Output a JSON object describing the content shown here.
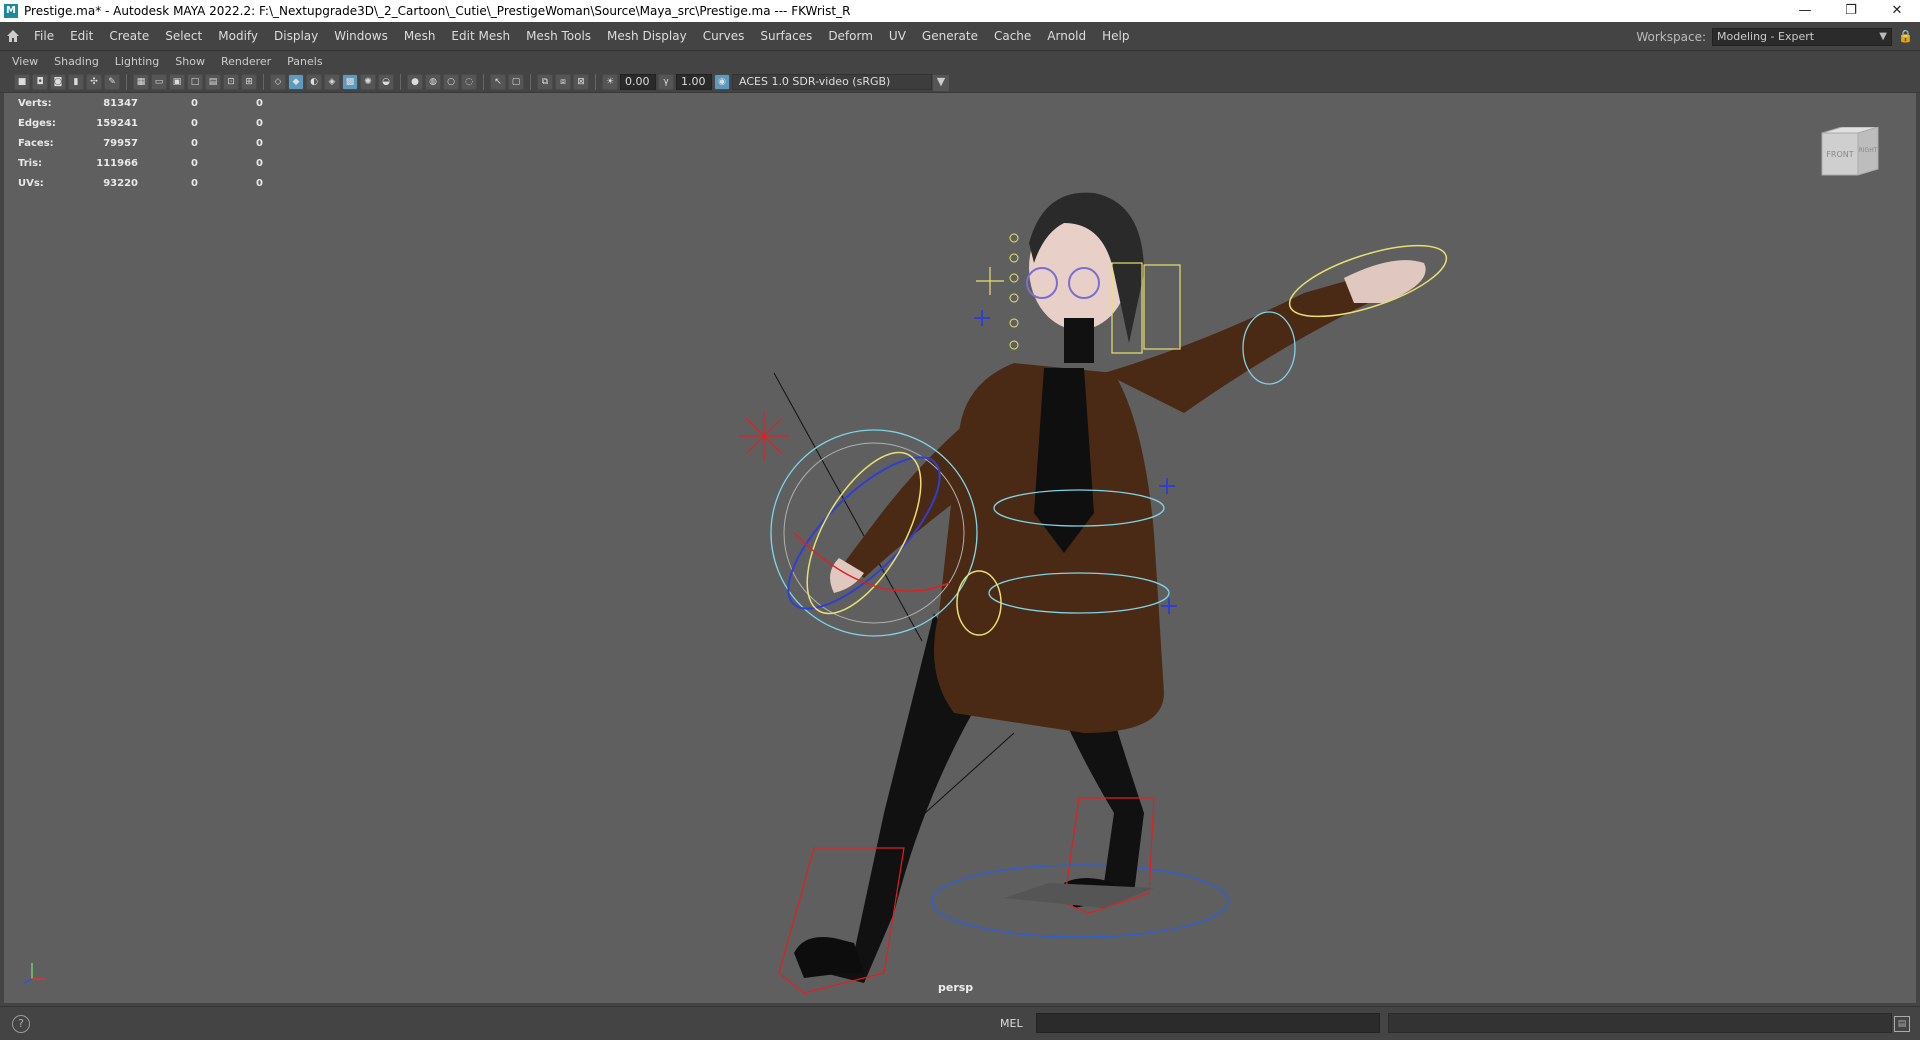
{
  "window": {
    "title": "Prestige.ma* - Autodesk MAYA 2022.2: F:\\_Nextupgrade3D\\_2_Cartoon\\_Cutie\\_PrestigeWoman\\Source\\Maya_src\\Prestige.ma  ---  FKWrist_R",
    "app_icon": "M",
    "minimize": "—",
    "maximize": "❐",
    "close": "✕"
  },
  "menus": [
    "File",
    "Edit",
    "Create",
    "Select",
    "Modify",
    "Display",
    "Windows",
    "Mesh",
    "Edit Mesh",
    "Mesh Tools",
    "Mesh Display",
    "Curves",
    "Surfaces",
    "Deform",
    "UV",
    "Generate",
    "Cache",
    "Arnold",
    "Help"
  ],
  "workspace": {
    "label": "Workspace:",
    "value": "Modeling - Expert"
  },
  "panel_menus": [
    "View",
    "Shading",
    "Lighting",
    "Show",
    "Renderer",
    "Panels"
  ],
  "toolbar": {
    "exposure": "0.00",
    "gamma": "1.00",
    "color_space": "ACES 1.0 SDR-video (sRGB)"
  },
  "hud": {
    "rows": [
      {
        "label": "Verts:",
        "value": "81347",
        "c1": "0",
        "c2": "0"
      },
      {
        "label": "Edges:",
        "value": "159241",
        "c1": "0",
        "c2": "0"
      },
      {
        "label": "Faces:",
        "value": "79957",
        "c1": "0",
        "c2": "0"
      },
      {
        "label": "Tris:",
        "value": "111966",
        "c1": "0",
        "c2": "0"
      },
      {
        "label": "UVs:",
        "value": "93220",
        "c1": "0",
        "c2": "0"
      }
    ]
  },
  "viewcube": {
    "front": "FRONT",
    "right": "RIGHT"
  },
  "camera": "persp",
  "status": {
    "mel": "MEL",
    "help": "?"
  },
  "colors": {
    "coat": "#4a2a15",
    "controls_cyan": "#7fd4e8",
    "controls_yellow": "#e8e070",
    "controls_red": "#e02020",
    "controls_blue": "#2f3fd0"
  }
}
